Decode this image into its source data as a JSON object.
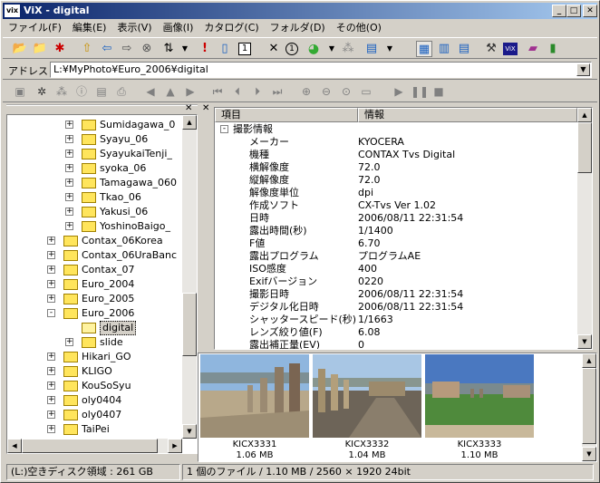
{
  "window": {
    "title": "ViX - digital",
    "app_icon": "vix"
  },
  "menu": [
    "ファイル(F)",
    "編集(E)",
    "表示(V)",
    "画像(I)",
    "カタログ(C)",
    "フォルダ(D)",
    "その他(O)"
  ],
  "address": {
    "label": "アドレス",
    "value": "L:¥MyPhoto¥Euro_2006¥digital"
  },
  "tree": [
    {
      "label": "Sumidagawa_0",
      "indent": 2,
      "expander": "+"
    },
    {
      "label": "Syayu_06",
      "indent": 2,
      "expander": "+"
    },
    {
      "label": "SyayukaiTenji_",
      "indent": 2,
      "expander": "+"
    },
    {
      "label": "syoka_06",
      "indent": 2,
      "expander": "+"
    },
    {
      "label": "Tamagawa_060",
      "indent": 2,
      "expander": "+"
    },
    {
      "label": "Tkao_06",
      "indent": 2,
      "expander": "+"
    },
    {
      "label": "Yakusi_06",
      "indent": 2,
      "expander": "+"
    },
    {
      "label": "YoshinoBaigo_",
      "indent": 2,
      "expander": "+"
    },
    {
      "label": "Contax_06Korea",
      "indent": 1,
      "expander": "+"
    },
    {
      "label": "Contax_06UraBanc",
      "indent": 1,
      "expander": "+"
    },
    {
      "label": "Contax_07",
      "indent": 1,
      "expander": "+"
    },
    {
      "label": "Euro_2004",
      "indent": 1,
      "expander": "+"
    },
    {
      "label": "Euro_2005",
      "indent": 1,
      "expander": "+"
    },
    {
      "label": "Euro_2006",
      "indent": 1,
      "expander": "-"
    },
    {
      "label": "digital",
      "indent": 2,
      "expander": "",
      "selected": true
    },
    {
      "label": "slide",
      "indent": 2,
      "expander": "+"
    },
    {
      "label": "Hikari_GO",
      "indent": 1,
      "expander": "+"
    },
    {
      "label": "KLIGO",
      "indent": 1,
      "expander": "+"
    },
    {
      "label": "KouSoSyu",
      "indent": 1,
      "expander": "+"
    },
    {
      "label": "oly0404",
      "indent": 1,
      "expander": "+"
    },
    {
      "label": "oly0407",
      "indent": 1,
      "expander": "+"
    },
    {
      "label": "TaiPei",
      "indent": 1,
      "expander": "+"
    }
  ],
  "props": {
    "col_item": "項目",
    "col_info": "情報",
    "group": "撮影情報",
    "group_expander": "-",
    "rows": [
      {
        "k": "メーカー",
        "v": "KYOCERA"
      },
      {
        "k": "機種",
        "v": "CONTAX Tvs Digital"
      },
      {
        "k": "横解像度",
        "v": "72.0"
      },
      {
        "k": "縦解像度",
        "v": "72.0"
      },
      {
        "k": "解像度単位",
        "v": "dpi"
      },
      {
        "k": "作成ソフト",
        "v": "CX-Tvs Ver 1.02"
      },
      {
        "k": "日時",
        "v": "2006/08/11 22:31:54"
      },
      {
        "k": "露出時間(秒)",
        "v": "1/1400"
      },
      {
        "k": "F値",
        "v": "6.70"
      },
      {
        "k": "露出プログラム",
        "v": "プログラムAE"
      },
      {
        "k": "ISO感度",
        "v": "400"
      },
      {
        "k": "Exifバージョン",
        "v": "0220"
      },
      {
        "k": "撮影日時",
        "v": "2006/08/11 22:31:54"
      },
      {
        "k": "デジタル化日時",
        "v": "2006/08/11 22:31:54"
      },
      {
        "k": "シャッタースピード(秒)",
        "v": "1/1663"
      },
      {
        "k": "レンズ絞り値(F)",
        "v": "6.08"
      },
      {
        "k": "露出補正量(EV)",
        "v": "0"
      }
    ]
  },
  "thumbnails": [
    {
      "name": "KICX3331",
      "size": "1.06 MB"
    },
    {
      "name": "KICX3332",
      "size": "1.04 MB"
    },
    {
      "name": "KICX3333",
      "size": "1.10 MB"
    }
  ],
  "status": {
    "disk": "(L:)空きディスク領域 : 261 GB",
    "file": "1 個のファイル / 1.10 MB / 2560 × 1920 24bit"
  },
  "colors": {
    "titlebar_start": "#0a246a",
    "titlebar_end": "#a6caf0",
    "folder": "#ffe55c"
  }
}
